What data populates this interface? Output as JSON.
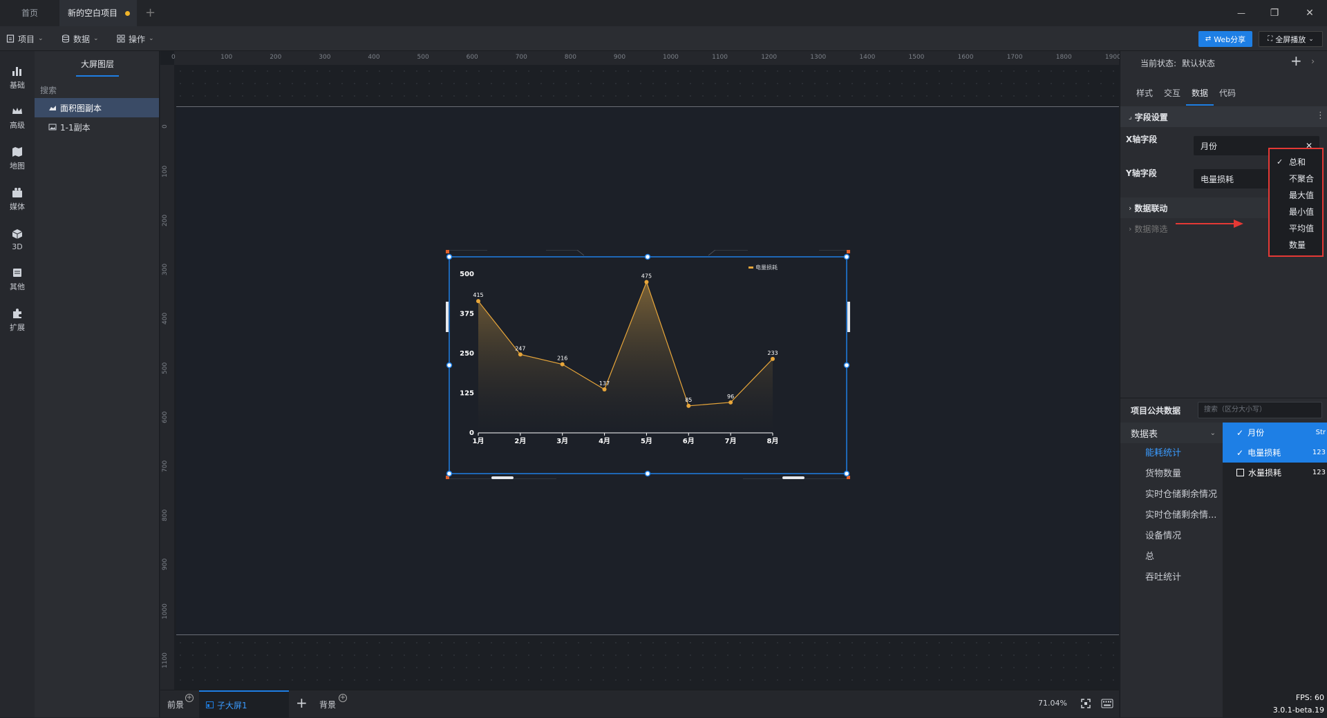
{
  "titlebar": {
    "tabs": [
      "首页",
      "新的空白项目"
    ],
    "add_tab": "+",
    "minimize": "—",
    "restore": "❐",
    "close": "✕"
  },
  "toolbar": {
    "menus": [
      "项目",
      "数据",
      "操作"
    ],
    "web_share": "Web分享",
    "fullscreen": "全屏播放"
  },
  "rail": {
    "items": [
      {
        "label": "基础",
        "icon": "bar-chart-icon"
      },
      {
        "label": "高级",
        "icon": "crown-icon"
      },
      {
        "label": "地图",
        "icon": "map-icon"
      },
      {
        "label": "媒体",
        "icon": "camera-icon"
      },
      {
        "label": "3D",
        "icon": "cube-icon"
      },
      {
        "label": "其他",
        "icon": "list-icon"
      },
      {
        "label": "扩展",
        "icon": "puzzle-icon"
      }
    ]
  },
  "layers": {
    "title": "大屏图层",
    "search_placeholder": "搜索",
    "items": [
      "面积图副本",
      "1-1副本"
    ]
  },
  "canvas": {
    "ruler_h": [
      "0",
      "100",
      "200",
      "300",
      "400",
      "500",
      "600",
      "700",
      "800",
      "900",
      "1000",
      "1100",
      "1200",
      "1300",
      "1400",
      "1500",
      "1600",
      "1700",
      "1800",
      "1900"
    ],
    "ruler_v": [
      "0",
      "100",
      "200",
      "300",
      "400",
      "500",
      "600",
      "700",
      "800",
      "900",
      "1000",
      "1100"
    ]
  },
  "chart_data": {
    "type": "area",
    "categories": [
      "1月",
      "2月",
      "3月",
      "4月",
      "5月",
      "6月",
      "7月",
      "8月"
    ],
    "series": [
      {
        "name": "电量损耗",
        "values": [
          415,
          247,
          216,
          137,
          475,
          85,
          96,
          233
        ]
      }
    ],
    "yticks": [
      "0",
      "125",
      "250",
      "375",
      "500"
    ],
    "ylim": [
      0,
      500
    ],
    "legend": "top-right",
    "color": "#e8a63a"
  },
  "rpanel": {
    "state_label": "当前状态:",
    "state_value": "默认状态",
    "add": "+",
    "collapse": "›",
    "tabs": [
      "样式",
      "交互",
      "数据",
      "代码"
    ],
    "section_fields": "字段设置",
    "more": "⋮",
    "x_label": "X轴字段",
    "x_value": "月份",
    "y_label": "Y轴字段",
    "y_value": "电量损耗",
    "remove": "✕",
    "section_link": "数据联动",
    "section_filter": "数据筛选",
    "aggregate_options": [
      "总和",
      "不聚合",
      "最大值",
      "最小值",
      "平均值",
      "数量"
    ],
    "aggregate_selected": "总和",
    "public_data_title": "项目公共数据",
    "public_search_placeholder": "搜索（区分大小写）",
    "table_group": "数据表",
    "tables": [
      "能耗统计",
      "货物数量",
      "实时仓储剩余情况",
      "实时仓储剩余情...",
      "设备情况",
      "总",
      "吞吐统计"
    ],
    "columns": [
      {
        "name": "月份",
        "type": "Str",
        "checked": true
      },
      {
        "name": "电量损耗",
        "type": "123",
        "checked": true
      },
      {
        "name": "水量损耗",
        "type": "123",
        "checked": false
      }
    ]
  },
  "bottombar": {
    "foreground": "前景",
    "screen_tab": "子大屏1",
    "add": "+",
    "background": "背景",
    "zoom": "71.04%",
    "fps": "FPS: 60",
    "version": "3.0.1-beta.19"
  },
  "colors": {
    "accent": "#1e7fe5",
    "highlight_red": "#e53935",
    "series_gold": "#e8a63a"
  }
}
